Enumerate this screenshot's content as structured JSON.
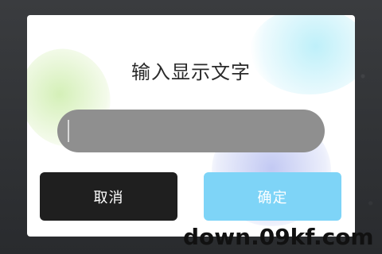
{
  "dialog": {
    "title": "输入显示文字",
    "input": {
      "value": "",
      "placeholder": ""
    },
    "buttons": {
      "cancel_label": "取消",
      "confirm_label": "确定"
    }
  },
  "watermark": "down.09kf.com",
  "colors": {
    "dialog_background": "#ffffff",
    "input_background": "#8f8f8f",
    "cancel_button": "#1f1f1f",
    "confirm_button": "#7ed4f7"
  },
  "icons": {
    "input_caret": "text-caret-icon"
  }
}
